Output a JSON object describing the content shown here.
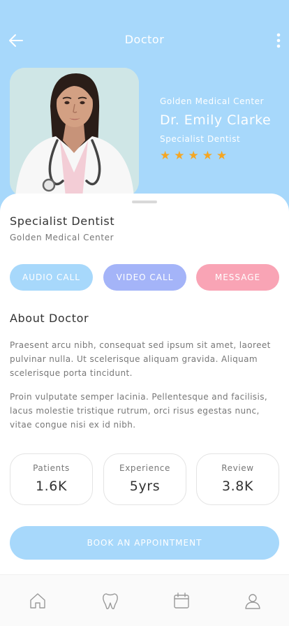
{
  "header": {
    "title": "Doctor"
  },
  "doctor": {
    "center": "Golden Medical Center",
    "name": "Dr. Emily Clarke",
    "specialty": "Specialist Dentist",
    "rating": 5
  },
  "sheet": {
    "title": "Specialist Dentist",
    "subtitle": "Golden Medical Center"
  },
  "actions": {
    "audio": "AUDIO CALL",
    "video": "VIDEO CALL",
    "message": "MESSAGE"
  },
  "about": {
    "title": "About Doctor",
    "p1": "Praesent arcu nibh, consequat sed ipsum sit amet, laoreet pulvinar nulla. Ut scelerisque aliquam gravida. Aliquam scelerisque porta tincidunt.",
    "p2": "Proin vulputate semper lacinia. Pellentesque and facilisis, lacus molestie tristique rutrum, orci risus egestas nunc, vitae congue nisi ex id nibh."
  },
  "stats": [
    {
      "label": "Patients",
      "value": "1.6K"
    },
    {
      "label": "Experience",
      "value": "5yrs"
    },
    {
      "label": "Review",
      "value": "3.8K"
    }
  ],
  "book": "BOOK AN APPOINTMENT",
  "colors": {
    "primary": "#a7d8fb",
    "video": "#a4b4f8",
    "message": "#f9a4b5",
    "star": "#f5a623"
  },
  "tabs": [
    "home-icon",
    "tooth-icon",
    "calendar-icon",
    "profile-icon"
  ]
}
